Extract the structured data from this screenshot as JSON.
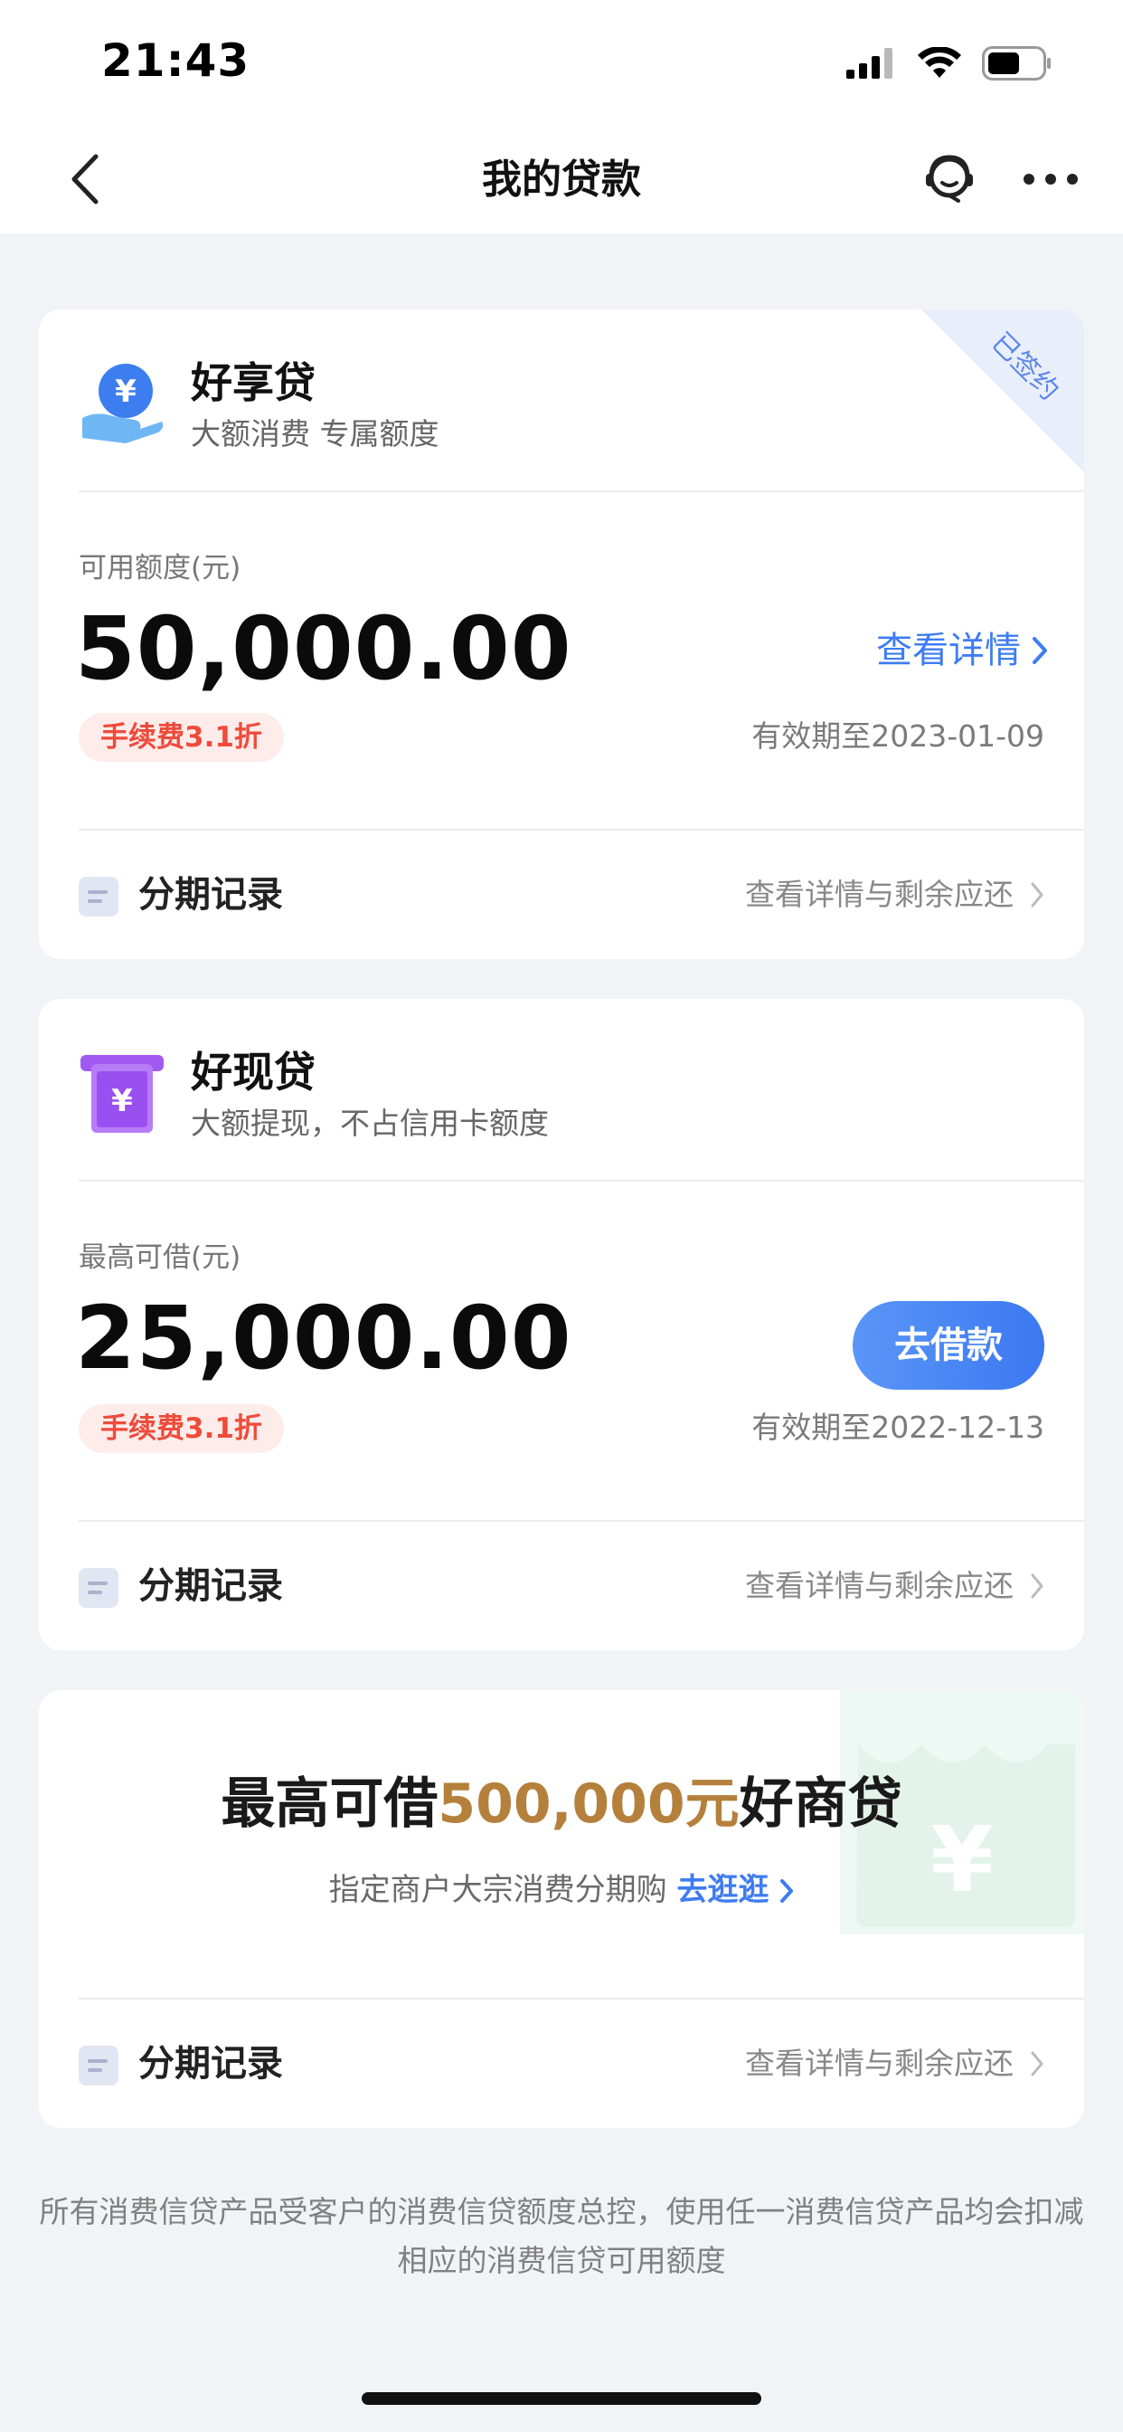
{
  "status_bar": {
    "time": "21:43"
  },
  "nav": {
    "title": "我的贷款"
  },
  "cards": [
    {
      "name": "好享贷",
      "subtitle": "大额消费 专属额度",
      "ribbon": "已签约",
      "amount_label": "可用额度(元)",
      "amount": "50,000.00",
      "fee_badge": "手续费3.1折",
      "validity": "有效期至2023-01-09",
      "detail_link": "查看详情",
      "record_title": "分期记录",
      "record_link": "查看详情与剩余应还"
    },
    {
      "name": "好现贷",
      "subtitle": "大额提现，不占信用卡额度",
      "amount_label": "最高可借(元)",
      "amount": "25,000.00",
      "fee_badge": "手续费3.1折",
      "validity": "有效期至2022-12-13",
      "button": "去借款",
      "record_title": "分期记录",
      "record_link": "查看详情与剩余应还"
    }
  ],
  "promo": {
    "title_pre": "最高可借",
    "title_highlight": "500,000元",
    "title_post": "好商贷",
    "subtitle": "指定商户大宗消费分期购",
    "go_link": "去逛逛",
    "record_title": "分期记录",
    "record_link": "查看详情与剩余应还"
  },
  "footer_note": "所有消费信贷产品受客户的消费信贷额度总控，使用任一消费信贷产品均会扣减相应的消费信贷可用额度",
  "colors": {
    "accent": "#3e7cf2",
    "fee_red": "#ee4b3b",
    "gold": "#b5803b",
    "background": "#f2f3f7"
  },
  "icons": [
    "back-chevron-icon",
    "customer-service-icon",
    "more-dots-icon",
    "yuan-hand-icon",
    "yuan-atm-icon",
    "record-doc-icon",
    "chevron-right-icon"
  ]
}
